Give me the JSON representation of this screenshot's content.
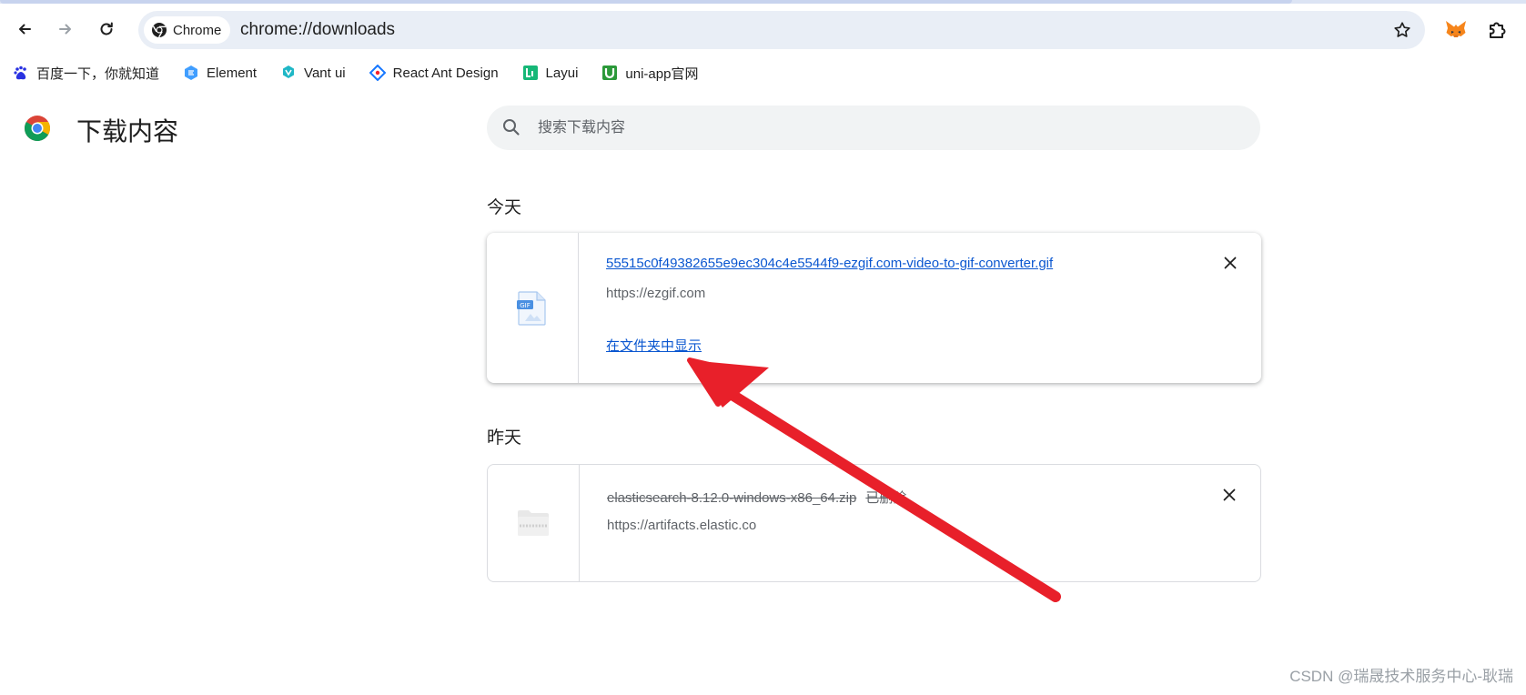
{
  "browser": {
    "chip_label": "Chrome",
    "url": "chrome://downloads"
  },
  "bookmarks": [
    {
      "label": "百度一下，你就知道",
      "icon": "baidu-icon"
    },
    {
      "label": "Element",
      "icon": "element-icon"
    },
    {
      "label": "Vant ui",
      "icon": "vant-icon"
    },
    {
      "label": "React Ant Design",
      "icon": "ant-design-icon"
    },
    {
      "label": "Layui",
      "icon": "layui-icon"
    },
    {
      "label": "uni-app官网",
      "icon": "uniapp-icon"
    }
  ],
  "page": {
    "title": "下载内容",
    "search_placeholder": "搜索下载内容"
  },
  "sections": [
    {
      "heading": "今天",
      "items": [
        {
          "filename": "55515c0f49382655e9ec304c4e5544f9-ezgif.com-video-to-gif-converter.gif",
          "source": "https://ezgif.com",
          "action": "在文件夹中显示",
          "icon": "gif-file-icon"
        }
      ]
    },
    {
      "heading": "昨天",
      "items": [
        {
          "filename": "elasticsearch-8.12.0-windows-x86_64.zip",
          "status": "已删除",
          "source": "https://artifacts.elastic.co",
          "icon": "zip-folder-icon"
        }
      ]
    }
  ],
  "colors": {
    "link": "#0b57d0",
    "annotation_arrow": "#e8202a"
  },
  "watermark": "CSDN @瑞晟技术服务中心-耿瑞"
}
